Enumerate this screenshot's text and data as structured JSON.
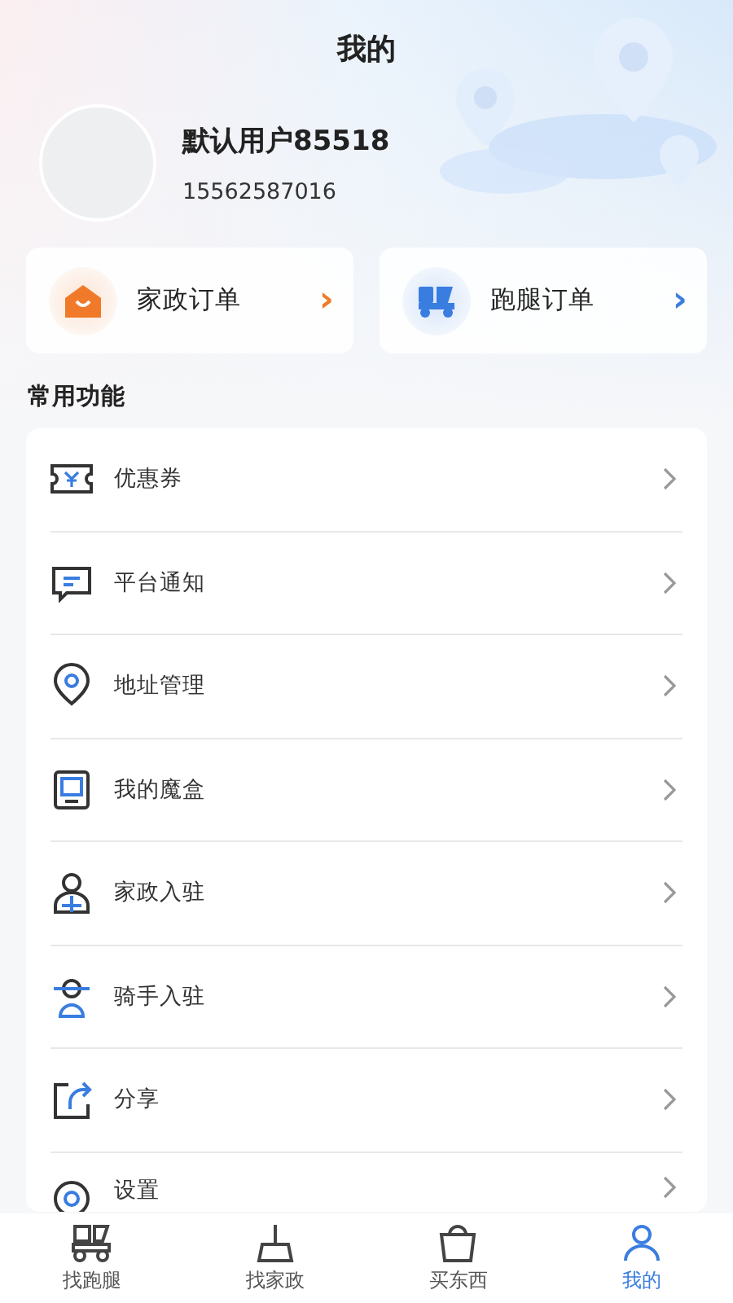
{
  "header": {
    "title": "我的"
  },
  "profile": {
    "name": "默认用户85518",
    "phone": "15562587016"
  },
  "order_cards": [
    {
      "label": "家政订单",
      "arrow": "›",
      "color": "#f07a2a"
    },
    {
      "label": "跑腿订单",
      "arrow": "›",
      "color": "#3a7de0"
    }
  ],
  "section_title": "常用功能",
  "menu": [
    {
      "label": "优惠券"
    },
    {
      "label": "平台通知"
    },
    {
      "label": "地址管理"
    },
    {
      "label": "我的魔盒"
    },
    {
      "label": "家政入驻"
    },
    {
      "label": "骑手入驻"
    },
    {
      "label": "分享"
    },
    {
      "label": "设置"
    }
  ],
  "tab_bar": [
    {
      "label": "找跑腿",
      "selected": false
    },
    {
      "label": "找家政",
      "selected": false
    },
    {
      "label": "买东西",
      "selected": false
    },
    {
      "label": "我的",
      "selected": true
    }
  ]
}
